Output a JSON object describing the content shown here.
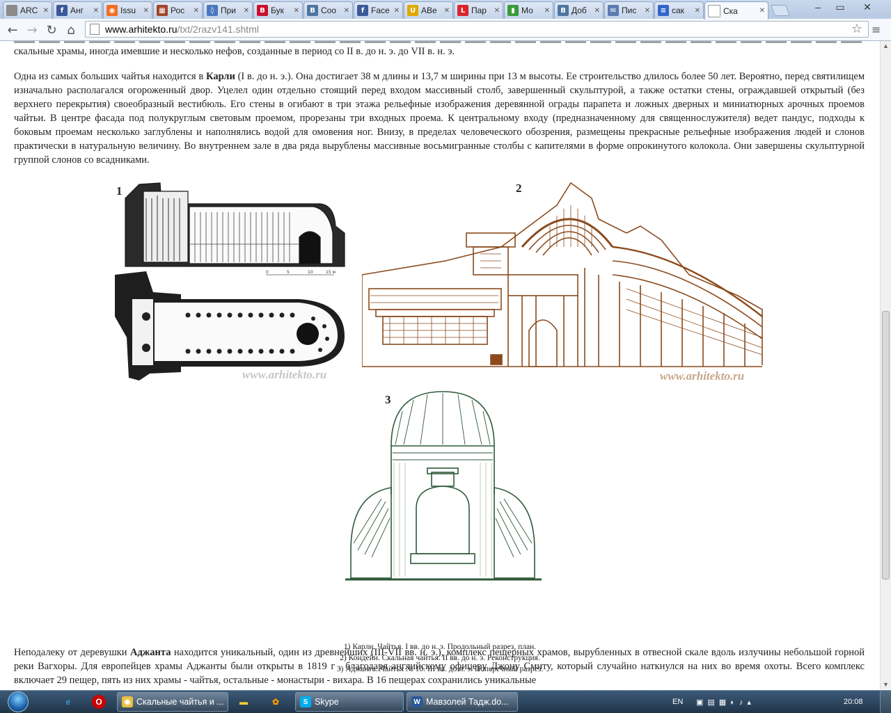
{
  "browser": {
    "tabs": [
      {
        "label": "ARC",
        "icon": "loading-spinner-icon",
        "color": "#8a8a8a",
        "glyph": ""
      },
      {
        "label": "Анг",
        "icon": "facebook-icon",
        "color": "#3b5998",
        "glyph": "f"
      },
      {
        "label": "Issu",
        "icon": "issuu-icon",
        "color": "#f36d21",
        "glyph": "◉"
      },
      {
        "label": "Рос",
        "icon": "brick-icon",
        "color": "#a0442a",
        "glyph": "▦"
      },
      {
        "label": "При",
        "icon": "drop-icon",
        "color": "#4a78c0",
        "glyph": "◊"
      },
      {
        "label": "Бук",
        "icon": "bukvoed-icon",
        "color": "#c8102e",
        "glyph": "B"
      },
      {
        "label": "Соо",
        "icon": "vk-icon",
        "color": "#4d76a1",
        "glyph": "B"
      },
      {
        "label": "Face",
        "icon": "facebook-icon",
        "color": "#3b5998",
        "glyph": "f"
      },
      {
        "label": "АВе",
        "icon": "u-icon",
        "color": "#e0a800",
        "glyph": "U"
      },
      {
        "label": "Пар",
        "icon": "l-icon",
        "color": "#d9242a",
        "glyph": "L"
      },
      {
        "label": "Мо",
        "icon": "chart-icon",
        "color": "#3a9a3a",
        "glyph": "▮"
      },
      {
        "label": "Доб",
        "icon": "vk-icon",
        "color": "#4d76a1",
        "glyph": "B"
      },
      {
        "label": "Пис",
        "icon": "mail-icon",
        "color": "#5a7ab0",
        "glyph": "✉"
      },
      {
        "label": "сак",
        "icon": "document-icon",
        "color": "#3366cc",
        "glyph": "≡"
      },
      {
        "label": "Ска",
        "icon": "page-icon",
        "color": "#ffffff",
        "glyph": ""
      }
    ],
    "url_host": "www.arhitekto.ru",
    "url_path": "/txt/2razv141.shtml"
  },
  "article": {
    "para_top": "скальные храмы, иногда имевшие и несколько нефов, созданные в период со II в. до н. э. до VII в. н. э.",
    "para_karli_before": "Одна из самых больших чайтья находится в ",
    "para_karli_bold": "Карли",
    "para_karli_after": " (I в. до н. э.). Она достигает 38 м длины и 13,7 м ширины при 13 м высоты. Ее строительство длилось более 50 лет. Вероятно, перед святилищем изначально располагался огороженный двор. Уцелел один отдельно стоящий перед входом массивный столб, завершенный скульптурой, а также остатки стены, ограждавшей открытый (без верхнего перекрытия) своеобразный вестибюль. Его стены в огибают в три этажа рельефные изображения деревянной ограды парапета и ложных дверных и миниатюрных арочных проемов чайтьи. В центре фасада под полукруглым световым проемом, прорезаны три входных проема. К центральному входу (предназначенному для священнослужителя) ведет пандус, подходы к боковым проемам несколько заглублены и наполнялись водой для омовения ног. Внизу, в пределах человеческого обозрения, размещены прекрасные рельефные изображения людей и слонов практически в натуральную величину. Во внутреннем зале в два ряда вырублены массивные восьмигранные столбы с капителями в форме опрокинутого колокола. Они завершены скульптурной группой слонов со всадниками.",
    "figure": {
      "label_1": "1",
      "label_2": "2",
      "label_3": "3",
      "scale_ticks": [
        "0",
        "5",
        "10",
        "15 м"
      ],
      "watermark": "www.arhitekto.ru",
      "caption": [
        "1) Карли. Чайтья. I вв. до н. э. Продольный разрез, план.",
        "2) Кондейн. Скальная чайтья. II вв. до н. э. Реконструкция.",
        "3) Аджанта. Чайтья № 10. III вв. до н. э. Поперечный разрез."
      ]
    },
    "para_ajanta_before": "Неподалеку от деревушки ",
    "para_ajanta_bold": "Аджанта",
    "para_ajanta_after": " находится уникальный, один из древнейших (III-VII вв. н. э.), комплекс пещерных храмов, вырубленных в отвесной скале вдоль излучины небольшой горной реки Вагхоры. Для европейцев храмы Аджанты были открыты в 1819 г . благодаря английскому офицеру Джону Смиту, который случайно наткнулся на них во время охоты. Всего комплекс включает 29 пещер, пять из них храмы - чайтья, остальные - монастыри - вихара. В 16 пещерах сохранились уникальные"
  },
  "taskbar": {
    "buttons": [
      {
        "label": "Скальные чайтья и ...",
        "icon": "chrome-icon",
        "color": "#e8c040",
        "glyph": "◉"
      },
      {
        "label": "Skype",
        "icon": "skype-icon",
        "color": "#00aff0",
        "glyph": "S"
      },
      {
        "label": "Мавзолей Тадж.do...",
        "icon": "word-icon",
        "color": "#2b5797",
        "glyph": "W"
      }
    ],
    "language": "EN",
    "time": "20:08"
  },
  "colors": {
    "figure1": "#1a1a1a",
    "figure2": "#8a4a1c",
    "figure3": "#2e5a3a",
    "watermark2": "#c8a789",
    "watermark1": "#c7c7c7"
  }
}
